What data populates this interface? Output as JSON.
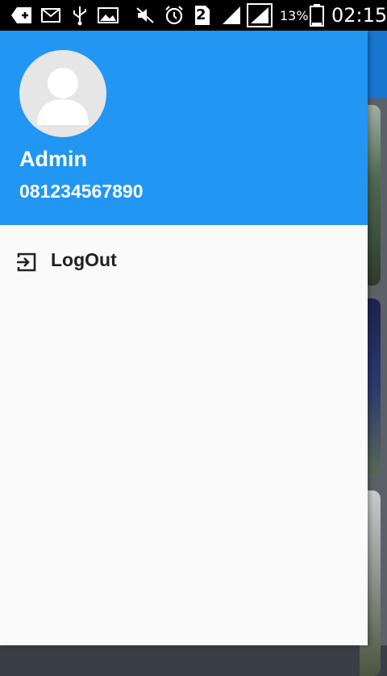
{
  "status_bar": {
    "icons": [
      "add-notification-icon",
      "mail-icon",
      "usb-icon",
      "image-icon",
      "mute-icon",
      "alarm-icon",
      "sim2-icon",
      "signal-icon",
      "signal-box-icon",
      "battery-icon"
    ],
    "sim_badge": "2",
    "battery_percent": "13%",
    "time": "02:15"
  },
  "drawer": {
    "avatar_icon": "person-icon",
    "user_name": "Admin",
    "user_phone": "081234567890",
    "header_color": "#2196f3",
    "menu_items": [
      {
        "icon": "logout-icon",
        "label": "LogOut"
      }
    ]
  }
}
